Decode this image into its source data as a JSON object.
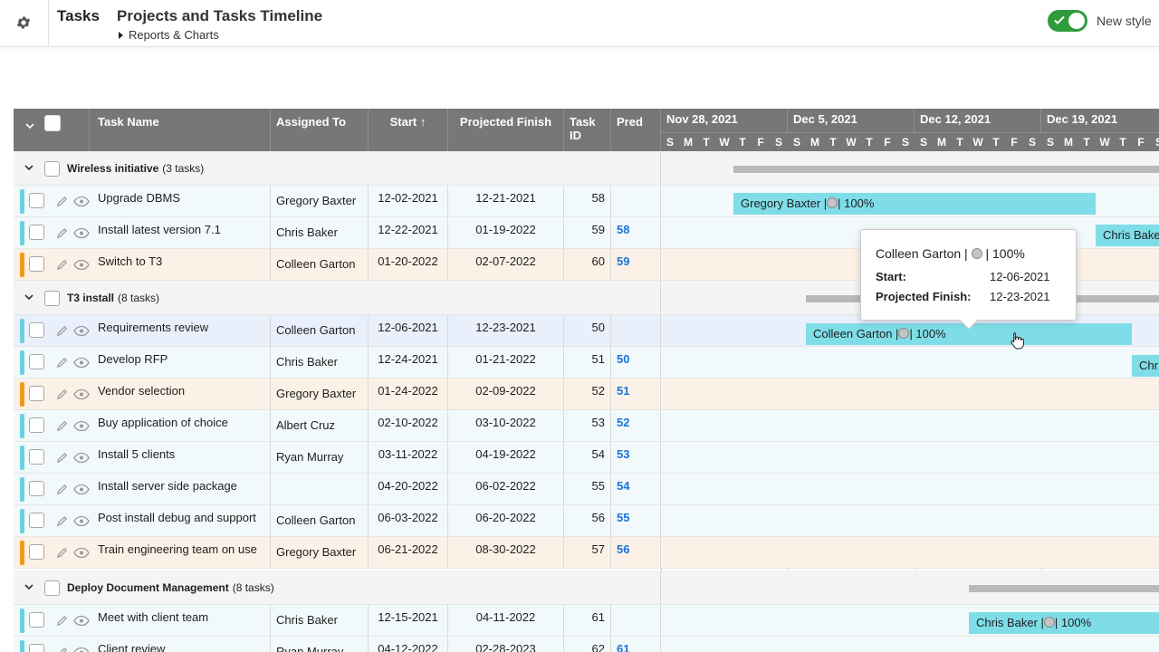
{
  "app": {
    "title": "Tasks",
    "page_title": "Projects and Tasks Timeline",
    "breadcrumb": "Reports & Charts",
    "toggle_label": "New style",
    "toggle_on": true
  },
  "columns": {
    "task_name": "Task Name",
    "assigned_to": "Assigned To",
    "start": "Start",
    "projected_finish": "Projected Finish",
    "task_id_line1": "Task",
    "task_id_line2": "ID",
    "pred": "Pred"
  },
  "timeline": {
    "weeks": [
      "Nov 28, 2021",
      "Dec 5, 2021",
      "Dec 12, 2021",
      "Dec 19, 2021"
    ],
    "day_letters": [
      "S",
      "M",
      "T",
      "W",
      "T",
      "F",
      "S",
      "S",
      "M",
      "T",
      "W",
      "T",
      "F",
      "S",
      "S",
      "M",
      "T",
      "W",
      "T",
      "F",
      "S",
      "S",
      "M",
      "T",
      "W",
      "T",
      "F",
      "S"
    ]
  },
  "groups": [
    {
      "name": "Wireless initiative",
      "count": "(3 tasks)",
      "tasks": [
        {
          "name": "Upgrade DBMS",
          "assigned": "Gregory Baxter",
          "start": "12-02-2021",
          "finish": "12-21-2021",
          "id": "58",
          "pred": "",
          "style": "normal"
        },
        {
          "name": "Install latest version 7.1",
          "assigned": "Chris Baker",
          "start": "12-22-2021",
          "finish": "01-19-2022",
          "id": "59",
          "pred": "58",
          "style": "normal"
        },
        {
          "name": "Switch to T3",
          "assigned": "Colleen Garton",
          "start": "01-20-2022",
          "finish": "02-07-2022",
          "id": "60",
          "pred": "59",
          "style": "late"
        }
      ]
    },
    {
      "name": "T3 install",
      "count": "(8 tasks)",
      "tasks": [
        {
          "name": "Requirements review",
          "assigned": "Colleen Garton",
          "start": "12-06-2021",
          "finish": "12-23-2021",
          "id": "50",
          "pred": "",
          "style": "sel"
        },
        {
          "name": "Develop RFP",
          "assigned": "Chris Baker",
          "start": "12-24-2021",
          "finish": "01-21-2022",
          "id": "51",
          "pred": "50",
          "style": "normal"
        },
        {
          "name": "Vendor selection",
          "assigned": "Gregory Baxter",
          "start": "01-24-2022",
          "finish": "02-09-2022",
          "id": "52",
          "pred": "51",
          "style": "late"
        },
        {
          "name": "Buy application of choice",
          "assigned": "Albert Cruz",
          "start": "02-10-2022",
          "finish": "03-10-2022",
          "id": "53",
          "pred": "52",
          "style": "normal"
        },
        {
          "name": "Install 5 clients",
          "assigned": "Ryan Murray",
          "start": "03-11-2022",
          "finish": "04-19-2022",
          "id": "54",
          "pred": "53",
          "style": "normal"
        },
        {
          "name": "Install server side package",
          "assigned": "",
          "start": "04-20-2022",
          "finish": "06-02-2022",
          "id": "55",
          "pred": "54",
          "style": "normal"
        },
        {
          "name": "Post install debug and support",
          "assigned": "Colleen Garton",
          "start": "06-03-2022",
          "finish": "06-20-2022",
          "id": "56",
          "pred": "55",
          "style": "normal"
        },
        {
          "name": "Train engineering team on use",
          "assigned": "Gregory Baxter",
          "start": "06-21-2022",
          "finish": "08-30-2022",
          "id": "57",
          "pred": "56",
          "style": "late"
        }
      ]
    },
    {
      "name": "Deploy Document Management",
      "count": "(8 tasks)",
      "tasks": [
        {
          "name": "Meet with client team",
          "assigned": "Chris Baker",
          "start": "12-15-2021",
          "finish": "04-11-2022",
          "id": "61",
          "pred": "",
          "style": "normal"
        },
        {
          "name": "Client review",
          "assigned": "Ryan Murray",
          "start": "04-12-2022",
          "finish": "02-28-2023",
          "id": "62",
          "pred": "61",
          "style": "normal"
        }
      ]
    }
  ],
  "bars": [
    {
      "label_name": "Gregory Baxter |",
      "label_pct": "| 100%"
    },
    {
      "label_name": "Chris Baker",
      "label_pct": ""
    },
    {
      "label_name": "Colleen Garton |",
      "label_pct": "| 100%"
    },
    {
      "label_name": "Chr",
      "label_pct": ""
    },
    {
      "label_name": "Chris Baker |",
      "label_pct": "| 100%"
    }
  ],
  "tooltip": {
    "header_name": "Colleen Garton |",
    "header_pct": "| 100%",
    "start_label": "Start:",
    "start_value": "12-06-2021",
    "finish_label": "Projected Finish:",
    "finish_value": "12-23-2021"
  },
  "colors": {
    "header_bg": "#777777",
    "bar": "#7fdde8",
    "stripe_normal": "#69d1e0",
    "stripe_late": "#f29a1a",
    "toggle": "#2e9c3b",
    "link": "#1b74d9"
  }
}
